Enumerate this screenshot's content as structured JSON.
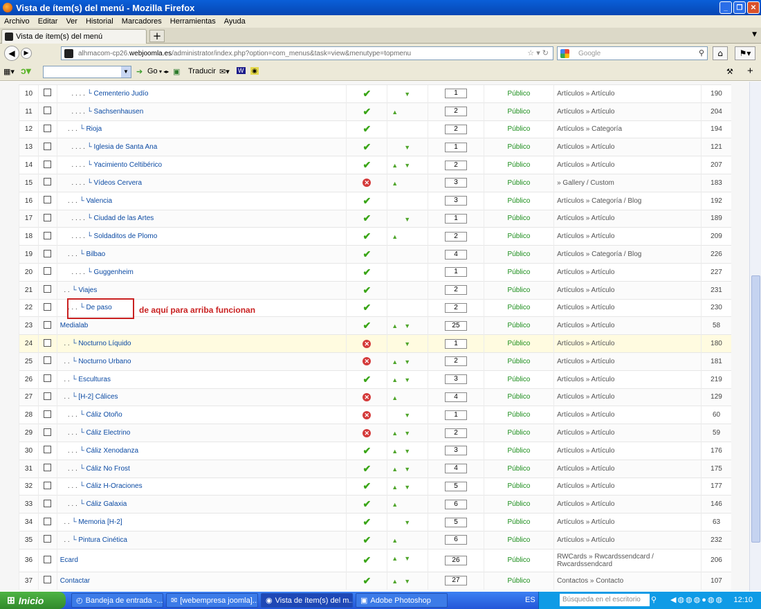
{
  "window": {
    "title": "Vista de ítem(s) del menú - Mozilla Firefox"
  },
  "menubar": [
    "Archivo",
    "Editar",
    "Ver",
    "Historial",
    "Marcadores",
    "Herramientas",
    "Ayuda"
  ],
  "tab": {
    "label": "Vista de ítem(s) del menú"
  },
  "url": {
    "prefix": "alhmacom-cp26.",
    "domain": "webjoomla.es",
    "path": "/administrator/index.php?option=com_menus&task=view&menutype=topmenu"
  },
  "search": {
    "placeholder": "Google"
  },
  "toolbar2": {
    "go": "Go",
    "traducir": "Traducir"
  },
  "annotation": "de aquí para arriba funcionan",
  "rows": [
    {
      "n": "10",
      "depth": "      . . . . ",
      "name": "Cementerio Judío",
      "pub": "ok",
      "up": false,
      "dn": true,
      "order": "1",
      "access": "Público",
      "type": "Artículos » Artículo",
      "id": "190"
    },
    {
      "n": "11",
      "depth": "      . . . . ",
      "name": "Sachsenhausen",
      "pub": "ok",
      "up": true,
      "dn": false,
      "order": "2",
      "access": "Público",
      "type": "Artículos » Artículo",
      "id": "204"
    },
    {
      "n": "12",
      "depth": "    . . . ",
      "name": "Rioja",
      "pub": "ok",
      "up": false,
      "dn": false,
      "order": "2",
      "access": "Público",
      "type": "Artículos » Categoría",
      "id": "194"
    },
    {
      "n": "13",
      "depth": "      . . . . ",
      "name": "Iglesia de Santa Ana",
      "pub": "ok",
      "up": false,
      "dn": true,
      "order": "1",
      "access": "Público",
      "type": "Artículos » Artículo",
      "id": "121"
    },
    {
      "n": "14",
      "depth": "      . . . . ",
      "name": "Yacimiento Celtibérico",
      "pub": "ok",
      "up": true,
      "dn": true,
      "order": "2",
      "access": "Público",
      "type": "Artículos » Artículo",
      "id": "207"
    },
    {
      "n": "15",
      "depth": "      . . . . ",
      "name": "Vídeos Cervera",
      "pub": "no",
      "up": true,
      "dn": false,
      "order": "3",
      "access": "Público",
      "type": "» Gallery / Custom",
      "id": "183"
    },
    {
      "n": "16",
      "depth": "    . . . ",
      "name": "Valencia",
      "pub": "ok",
      "up": false,
      "dn": false,
      "order": "3",
      "access": "Público",
      "type": "Artículos » Categoría / Blog",
      "id": "192"
    },
    {
      "n": "17",
      "depth": "      . . . . ",
      "name": "Ciudad de las Artes",
      "pub": "ok",
      "up": false,
      "dn": true,
      "order": "1",
      "access": "Público",
      "type": "Artículos » Artículo",
      "id": "189"
    },
    {
      "n": "18",
      "depth": "      . . . . ",
      "name": "Soldaditos de Plomo",
      "pub": "ok",
      "up": true,
      "dn": false,
      "order": "2",
      "access": "Público",
      "type": "Artículos » Artículo",
      "id": "209"
    },
    {
      "n": "19",
      "depth": "    . . . ",
      "name": "Bilbao",
      "pub": "ok",
      "up": false,
      "dn": false,
      "order": "4",
      "access": "Público",
      "type": "Artículos » Categoría / Blog",
      "id": "226"
    },
    {
      "n": "20",
      "depth": "      . . . . ",
      "name": "Guggenheim",
      "pub": "ok",
      "up": false,
      "dn": false,
      "order": "1",
      "access": "Público",
      "type": "Artículos » Artículo",
      "id": "227"
    },
    {
      "n": "21",
      "depth": "  . . ",
      "name": "Viajes",
      "pub": "ok",
      "up": false,
      "dn": false,
      "order": "2",
      "access": "Público",
      "type": "Artículos » Artículo",
      "id": "231"
    },
    {
      "n": "22",
      "depth": "    . . . ",
      "name": "De paso",
      "pub": "ok",
      "up": false,
      "dn": false,
      "order": "2",
      "access": "Público",
      "type": "Artículos » Artículo",
      "id": "230"
    },
    {
      "n": "23",
      "depth": "",
      "name": "Medialab",
      "pub": "ok",
      "up": true,
      "dn": true,
      "order": "25",
      "access": "Público",
      "type": "Artículos » Artículo",
      "id": "58"
    },
    {
      "n": "24",
      "depth": "  . . ",
      "name": "Nocturno Líquido",
      "pub": "no",
      "up": false,
      "dn": true,
      "order": "1",
      "access": "Público",
      "type": "Artículos » Artículo",
      "id": "180",
      "hl": true
    },
    {
      "n": "25",
      "depth": "  . . ",
      "name": "Nocturno Urbano",
      "pub": "no",
      "up": true,
      "dn": true,
      "order": "2",
      "access": "Público",
      "type": "Artículos » Artículo",
      "id": "181"
    },
    {
      "n": "26",
      "depth": "  . . ",
      "name": "Esculturas",
      "pub": "ok",
      "up": true,
      "dn": true,
      "order": "3",
      "access": "Público",
      "type": "Artículos » Artículo",
      "id": "219"
    },
    {
      "n": "27",
      "depth": "  . . ",
      "name": "[H-2] Cálices",
      "pub": "no",
      "up": true,
      "dn": false,
      "order": "4",
      "access": "Público",
      "type": "Artículos » Artículo",
      "id": "129"
    },
    {
      "n": "28",
      "depth": "    . . . ",
      "name": "Cáliz Otoño",
      "pub": "no",
      "up": false,
      "dn": true,
      "order": "1",
      "access": "Público",
      "type": "Artículos » Artículo",
      "id": "60"
    },
    {
      "n": "29",
      "depth": "    . . . ",
      "name": "Cáliz Electrino",
      "pub": "no",
      "up": true,
      "dn": true,
      "order": "2",
      "access": "Público",
      "type": "Artículos » Artículo",
      "id": "59"
    },
    {
      "n": "30",
      "depth": "    . . . ",
      "name": "Cáliz Xenodanza",
      "pub": "ok",
      "up": true,
      "dn": true,
      "order": "3",
      "access": "Público",
      "type": "Artículos » Artículo",
      "id": "176"
    },
    {
      "n": "31",
      "depth": "    . . . ",
      "name": "Cáliz No Frost",
      "pub": "ok",
      "up": true,
      "dn": true,
      "order": "4",
      "access": "Público",
      "type": "Artículos » Artículo",
      "id": "175"
    },
    {
      "n": "32",
      "depth": "    . . . ",
      "name": "Cáliz H-Oraciones",
      "pub": "ok",
      "up": true,
      "dn": true,
      "order": "5",
      "access": "Público",
      "type": "Artículos » Artículo",
      "id": "177"
    },
    {
      "n": "33",
      "depth": "    . . . ",
      "name": "Cáliz Galaxia",
      "pub": "ok",
      "up": true,
      "dn": false,
      "order": "6",
      "access": "Público",
      "type": "Artículos » Artículo",
      "id": "146"
    },
    {
      "n": "34",
      "depth": "  . . ",
      "name": "Memoria [H-2]",
      "pub": "ok",
      "up": false,
      "dn": true,
      "order": "5",
      "access": "Público",
      "type": "Artículos » Artículo",
      "id": "63"
    },
    {
      "n": "35",
      "depth": "  . . ",
      "name": "Pintura Cinética",
      "pub": "ok",
      "up": true,
      "dn": false,
      "order": "6",
      "access": "Público",
      "type": "Artículos » Artículo",
      "id": "232"
    },
    {
      "n": "36",
      "depth": "",
      "name": "Ecard",
      "pub": "ok",
      "up": true,
      "dn": true,
      "order": "26",
      "access": "Público",
      "type": "RWCards » Rwcardssendcard / Rwcardssendcard",
      "id": "206",
      "tall": true
    },
    {
      "n": "37",
      "depth": "",
      "name": "Contactar",
      "pub": "ok",
      "up": true,
      "dn": true,
      "order": "27",
      "access": "Público",
      "type": "Contactos » Contacto",
      "id": "107"
    }
  ],
  "taskbar": {
    "start": "Inicio",
    "tasks": [
      "Bandeja de entrada -...",
      "[webempresa joomla]...",
      "Vista de ítem(s) del m...",
      "Adobe Photoshop"
    ],
    "lang": "ES",
    "desk_search": "Búsqueda en el escritorio",
    "clock": "12:10"
  },
  "colors": {
    "title_bar": "#0646b3",
    "link": "#0b4aa3",
    "publish_ok": "#3aa517",
    "unpublished": "#d43a3a",
    "annotation": "#c92121",
    "highlight_row": "#fffbe0"
  }
}
